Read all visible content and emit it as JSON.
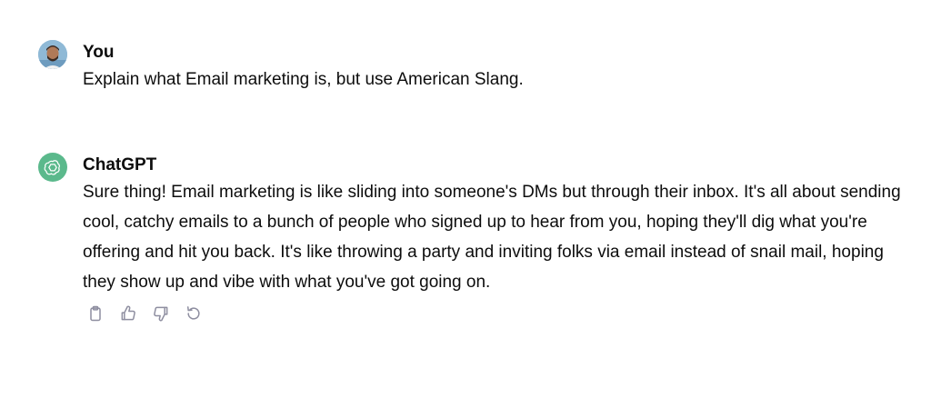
{
  "conversation": {
    "user": {
      "name": "You",
      "message": "Explain what Email marketing is, but use American Slang.",
      "avatar_icon": "user-avatar"
    },
    "assistant": {
      "name": "ChatGPT",
      "message": "Sure thing! Email marketing is like sliding into someone's DMs but through their inbox. It's all about sending cool, catchy emails to a bunch of people who signed up to hear from you, hoping they'll dig what you're offering and hit you back. It's like throwing a party and inviting folks via email instead of snail mail, hoping they show up and vibe with what you've got going on.",
      "avatar_icon": "openai-logo-icon",
      "actions": [
        {
          "name": "copy",
          "icon": "clipboard-icon"
        },
        {
          "name": "thumbs-up",
          "icon": "thumbs-up-icon"
        },
        {
          "name": "thumbs-down",
          "icon": "thumbs-down-icon"
        },
        {
          "name": "regenerate",
          "icon": "regenerate-icon"
        }
      ]
    }
  },
  "colors": {
    "text": "#0d0d0d",
    "icon": "#8e8ea0",
    "bot_avatar": "#5bb98c",
    "user_avatar_bg": "#8fb9d6"
  }
}
